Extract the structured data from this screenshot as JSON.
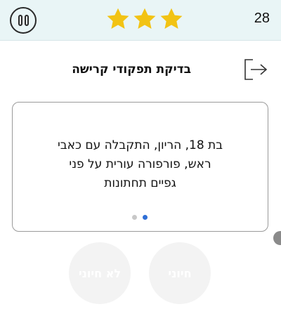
{
  "header": {
    "pause_icon": "pause-icon",
    "stars": [
      {
        "icon": "star-icon",
        "color": "#f2c314"
      },
      {
        "icon": "star-icon",
        "color": "#f2c314"
      },
      {
        "icon": "star-icon",
        "color": "#f2c314"
      }
    ],
    "score": "28"
  },
  "question": {
    "title": "בדיקת תפקודי קרישה",
    "exit_icon": "exit-icon"
  },
  "card": {
    "lines": [
      "בת 18, הריון, התקבלה עם כאבי",
      "ראש, פורפורה עורית על פני",
      "גפיים תחתונות"
    ],
    "pagination": {
      "total": 2,
      "active": 2
    },
    "active_color": "#2f6fd6"
  },
  "answers": {
    "no_label": "לא חיוני",
    "yes_label": "חיוני"
  },
  "colors": {
    "header_background": "#e9f5f6",
    "star": "#f2c314"
  }
}
